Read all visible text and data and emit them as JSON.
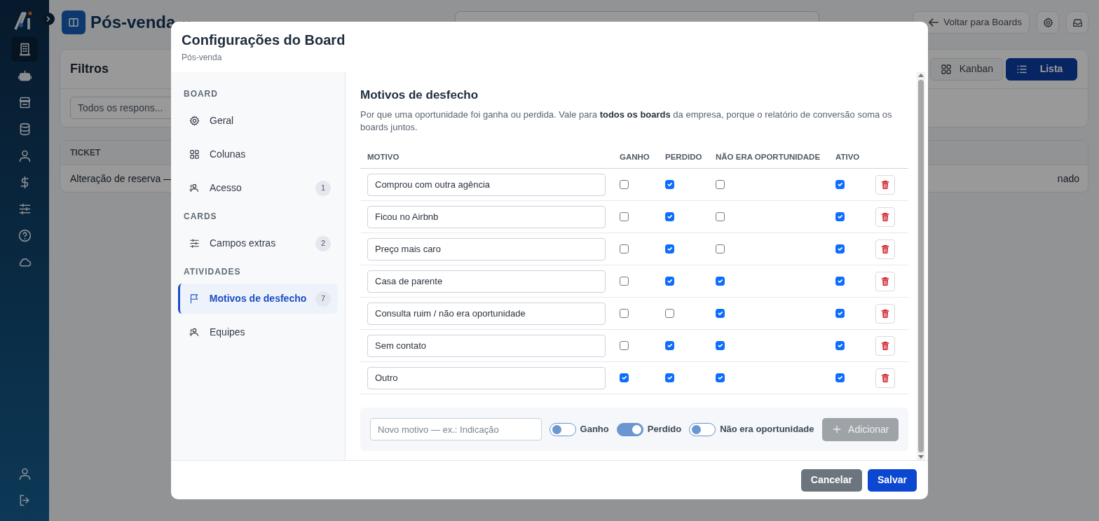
{
  "app_sidebar": {
    "top_items": [
      {
        "selected": true
      },
      {
        "selected": false
      },
      {
        "selected": false
      },
      {
        "selected": false
      },
      {
        "selected": false
      },
      {
        "selected": false
      },
      {
        "selected": false
      },
      {
        "selected": false
      },
      {
        "selected": false
      }
    ],
    "bottom_items": [
      {
        "selected": false
      },
      {
        "selected": false
      }
    ]
  },
  "header": {
    "board_title": "Pós-venda",
    "back_button": "Voltar para Boards"
  },
  "filters": {
    "title": "Filtros",
    "responsible_select": "Todos os respons...",
    "views": [
      {
        "label": "Kanban",
        "selected": false
      },
      {
        "label": "Lista",
        "selected": true
      }
    ]
  },
  "tickets_table": {
    "columns": [
      "TICKET"
    ],
    "rows": [
      {
        "cells": [
          "Alteração de reserva —",
          "nado"
        ]
      }
    ]
  },
  "modal": {
    "title": "Configurações do Board",
    "subtitle": "Pós-venda",
    "nav": [
      {
        "heading": "BOARD",
        "items": [
          {
            "label": "Geral",
            "selected": false
          },
          {
            "label": "Colunas",
            "selected": false
          },
          {
            "label": "Acesso",
            "count": "1",
            "selected": false
          }
        ]
      },
      {
        "heading": "CARDS",
        "items": [
          {
            "label": "Campos extras",
            "count": "2",
            "selected": false
          }
        ]
      },
      {
        "heading": "ATIVIDADES",
        "items": [
          {
            "label": "Motivos de desfecho",
            "count": "7",
            "selected": true
          },
          {
            "label": "Equipes",
            "selected": false
          }
        ]
      }
    ],
    "section": {
      "title": "Motivos de desfecho",
      "description": "Por que uma oportunidade foi ganha ou perdida. Vale para **todos os boards** da empresa, porque o relatório de conversão soma os boards juntos.",
      "columns": [
        "MOTIVO",
        "GANHO",
        "PERDIDO",
        "NÃO ERA OPORTUNIDADE",
        "ATIVO"
      ],
      "reasons": [
        {
          "value": "Comprou com outra agência",
          "won": false,
          "lost": true,
          "not_opportunity": false,
          "active": true
        },
        {
          "value": "Ficou no Airbnb",
          "won": false,
          "lost": true,
          "not_opportunity": false,
          "active": true
        },
        {
          "value": "Preço mais caro",
          "won": false,
          "lost": true,
          "not_opportunity": false,
          "active": true
        },
        {
          "value": "Casa de parente",
          "won": false,
          "lost": true,
          "not_opportunity": true,
          "active": true
        },
        {
          "value": "Consulta ruim / não era oportunidade",
          "won": false,
          "lost": false,
          "not_opportunity": true,
          "active": true
        },
        {
          "value": "Sem contato",
          "won": false,
          "lost": true,
          "not_opportunity": true,
          "active": true
        },
        {
          "value": "Outro",
          "won": true,
          "lost": true,
          "not_opportunity": true,
          "active": true
        }
      ],
      "new_reason": {
        "placeholder": "Novo motivo — ex.: Indicação",
        "toggles": [
          {
            "label": "Ganho",
            "on": false
          },
          {
            "label": "Perdido",
            "on": true
          },
          {
            "label": "Não era oportunidade",
            "on": false
          }
        ],
        "add_button": {
          "label": "Adicionar",
          "disabled": true
        }
      }
    },
    "footer": {
      "cancel": "Cancelar",
      "save": "Salvar"
    }
  }
}
